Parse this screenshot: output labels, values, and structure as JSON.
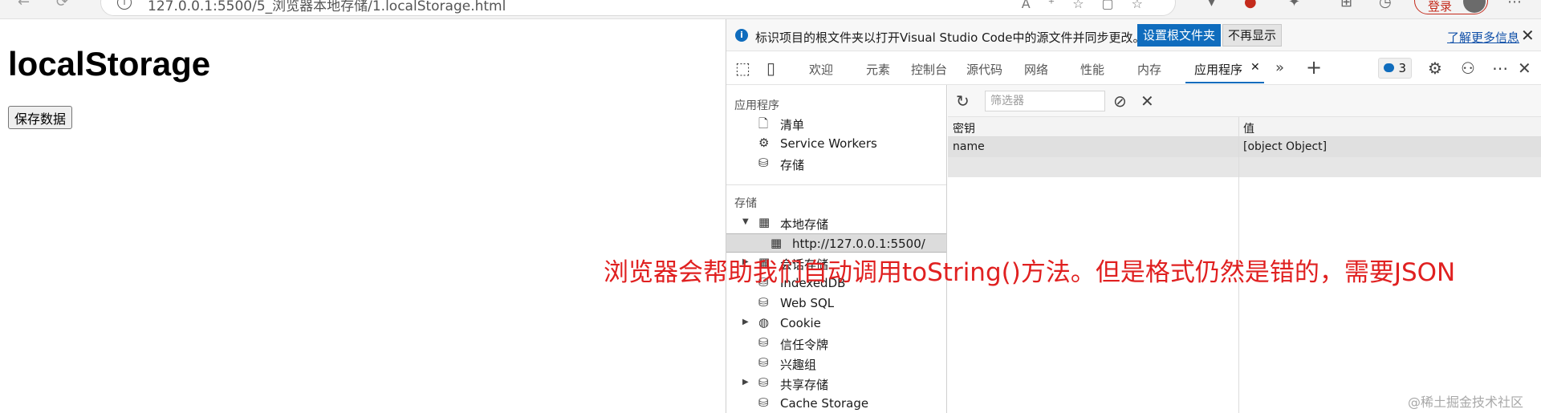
{
  "browser": {
    "url": "127.0.0.1:5500/5_浏览器本地存储/1.localStorage.html",
    "login_label": "登录"
  },
  "page": {
    "heading": "localStorage",
    "save_button": "保存数据"
  },
  "devtools": {
    "infobar": {
      "message": "标识项目的根文件夹以打开Visual Studio Code中的源文件并同步更改。",
      "set_root_button": "设置根文件夹",
      "dismiss_button": "不再显示",
      "learn_more": "了解更多信息"
    },
    "tabs": [
      "欢迎",
      "元素",
      "控制台",
      "源代码",
      "网络",
      "性能",
      "内存",
      "应用程序"
    ],
    "active_tab": "应用程序",
    "issues_count": "3",
    "sidebar": {
      "section_app": "应用程序",
      "app_items": [
        "清单",
        "Service Workers",
        "存储"
      ],
      "section_storage": "存储",
      "local_storage": "本地存储",
      "local_storage_origin": "http://127.0.0.1:5500/",
      "session_storage": "会话存储",
      "storage_items": [
        "IndexedDB",
        "Web SQL",
        "Cookie",
        "信任令牌",
        "兴趣组",
        "共享存储",
        "Cache Storage"
      ]
    },
    "main": {
      "filter_placeholder": "筛选器",
      "columns": [
        "密钥",
        "值"
      ],
      "rows": [
        {
          "key": "name",
          "value": "[object Object]"
        }
      ]
    }
  },
  "annotation": "浏览器会帮助我们自动调用toString()方法。但是格式仍然是错的，需要JSON",
  "watermark": "@稀土掘金技术社区",
  "colors": {
    "accent": "#0f6cbd",
    "annotation": "#e02020"
  }
}
